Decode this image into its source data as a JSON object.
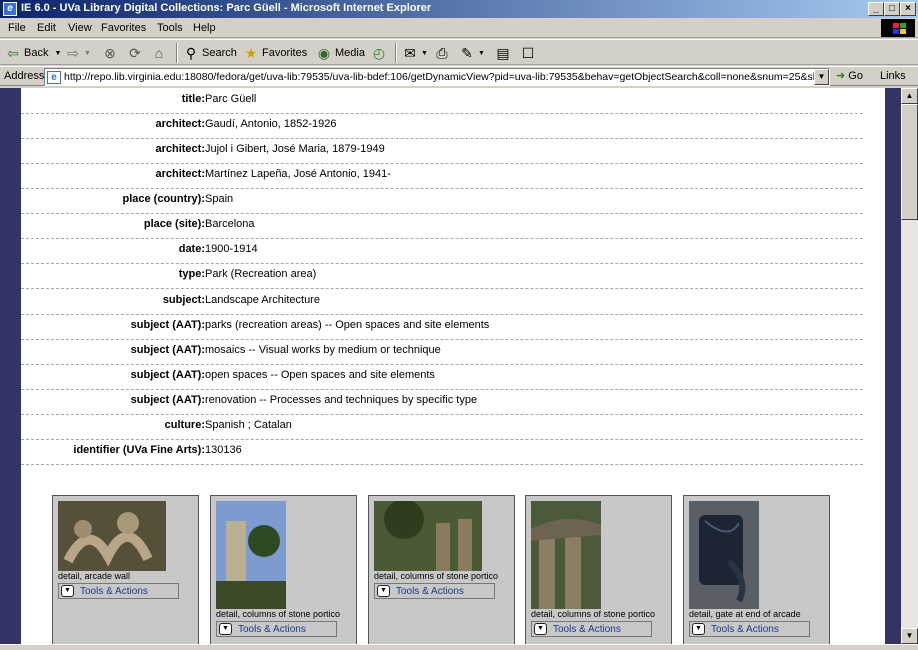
{
  "window": {
    "title": "IE 6.0 - UVa Library Digital Collections: Parc Güell - Microsoft Internet Explorer",
    "icon": "ie-icon"
  },
  "menu": [
    "File",
    "Edit",
    "View",
    "Favorites",
    "Tools",
    "Help"
  ],
  "toolbar": {
    "back": "Back",
    "search": "Search",
    "favorites": "Favorites",
    "media": "Media"
  },
  "address": {
    "label": "Address",
    "url": "http://repo.lib.virginia.edu:18080/fedora/get/uva-lib:79535/uva-lib-bdef:106/getDynamicView?pid=uva-lib:79535&behav=getObjectSearch&coll=none&snum=25&sblk=1&ref",
    "go": "Go",
    "links": "Links"
  },
  "metadata": [
    {
      "label": "title:",
      "value": "Parc Güell"
    },
    {
      "label": "architect:",
      "value": "Gaudí, Antonio, 1852-1926"
    },
    {
      "label": "architect:",
      "value": "Jujol i Gibert, José Maria, 1879-1949"
    },
    {
      "label": "architect:",
      "value": "Martínez Lapeña, José Antonio, 1941-"
    },
    {
      "label": "place (country):",
      "value": "Spain"
    },
    {
      "label": "place (site):",
      "value": "Barcelona"
    },
    {
      "label": "date:",
      "value": "1900-1914"
    },
    {
      "label": "type:",
      "value": "Park (Recreation area)"
    },
    {
      "label": "subject:",
      "value": "Landscape Architecture"
    },
    {
      "label": "subject (AAT):",
      "value": "parks (recreation areas) -- Open spaces and site elements"
    },
    {
      "label": "subject (AAT):",
      "value": "mosaics -- Visual works by medium or technique"
    },
    {
      "label": "subject (AAT):",
      "value": "open spaces -- Open spaces and site elements"
    },
    {
      "label": "subject (AAT):",
      "value": "renovation -- Processes and techniques by specific type"
    },
    {
      "label": "culture:",
      "value": "Spanish ; Catalan"
    },
    {
      "label": "identifier (UVa Fine Arts):",
      "value": "130136"
    }
  ],
  "thumbnails": [
    {
      "caption": "detail, arcade wall",
      "action": "Tools & Actions"
    },
    {
      "caption": "detail, columns of stone portico",
      "action": "Tools & Actions"
    },
    {
      "caption": "detail, columns of stone portico",
      "action": "Tools & Actions"
    },
    {
      "caption": "detail, columns of stone portico",
      "action": "Tools & Actions"
    },
    {
      "caption": "detail, gate at end of arcade",
      "action": "Tools & Actions"
    }
  ]
}
